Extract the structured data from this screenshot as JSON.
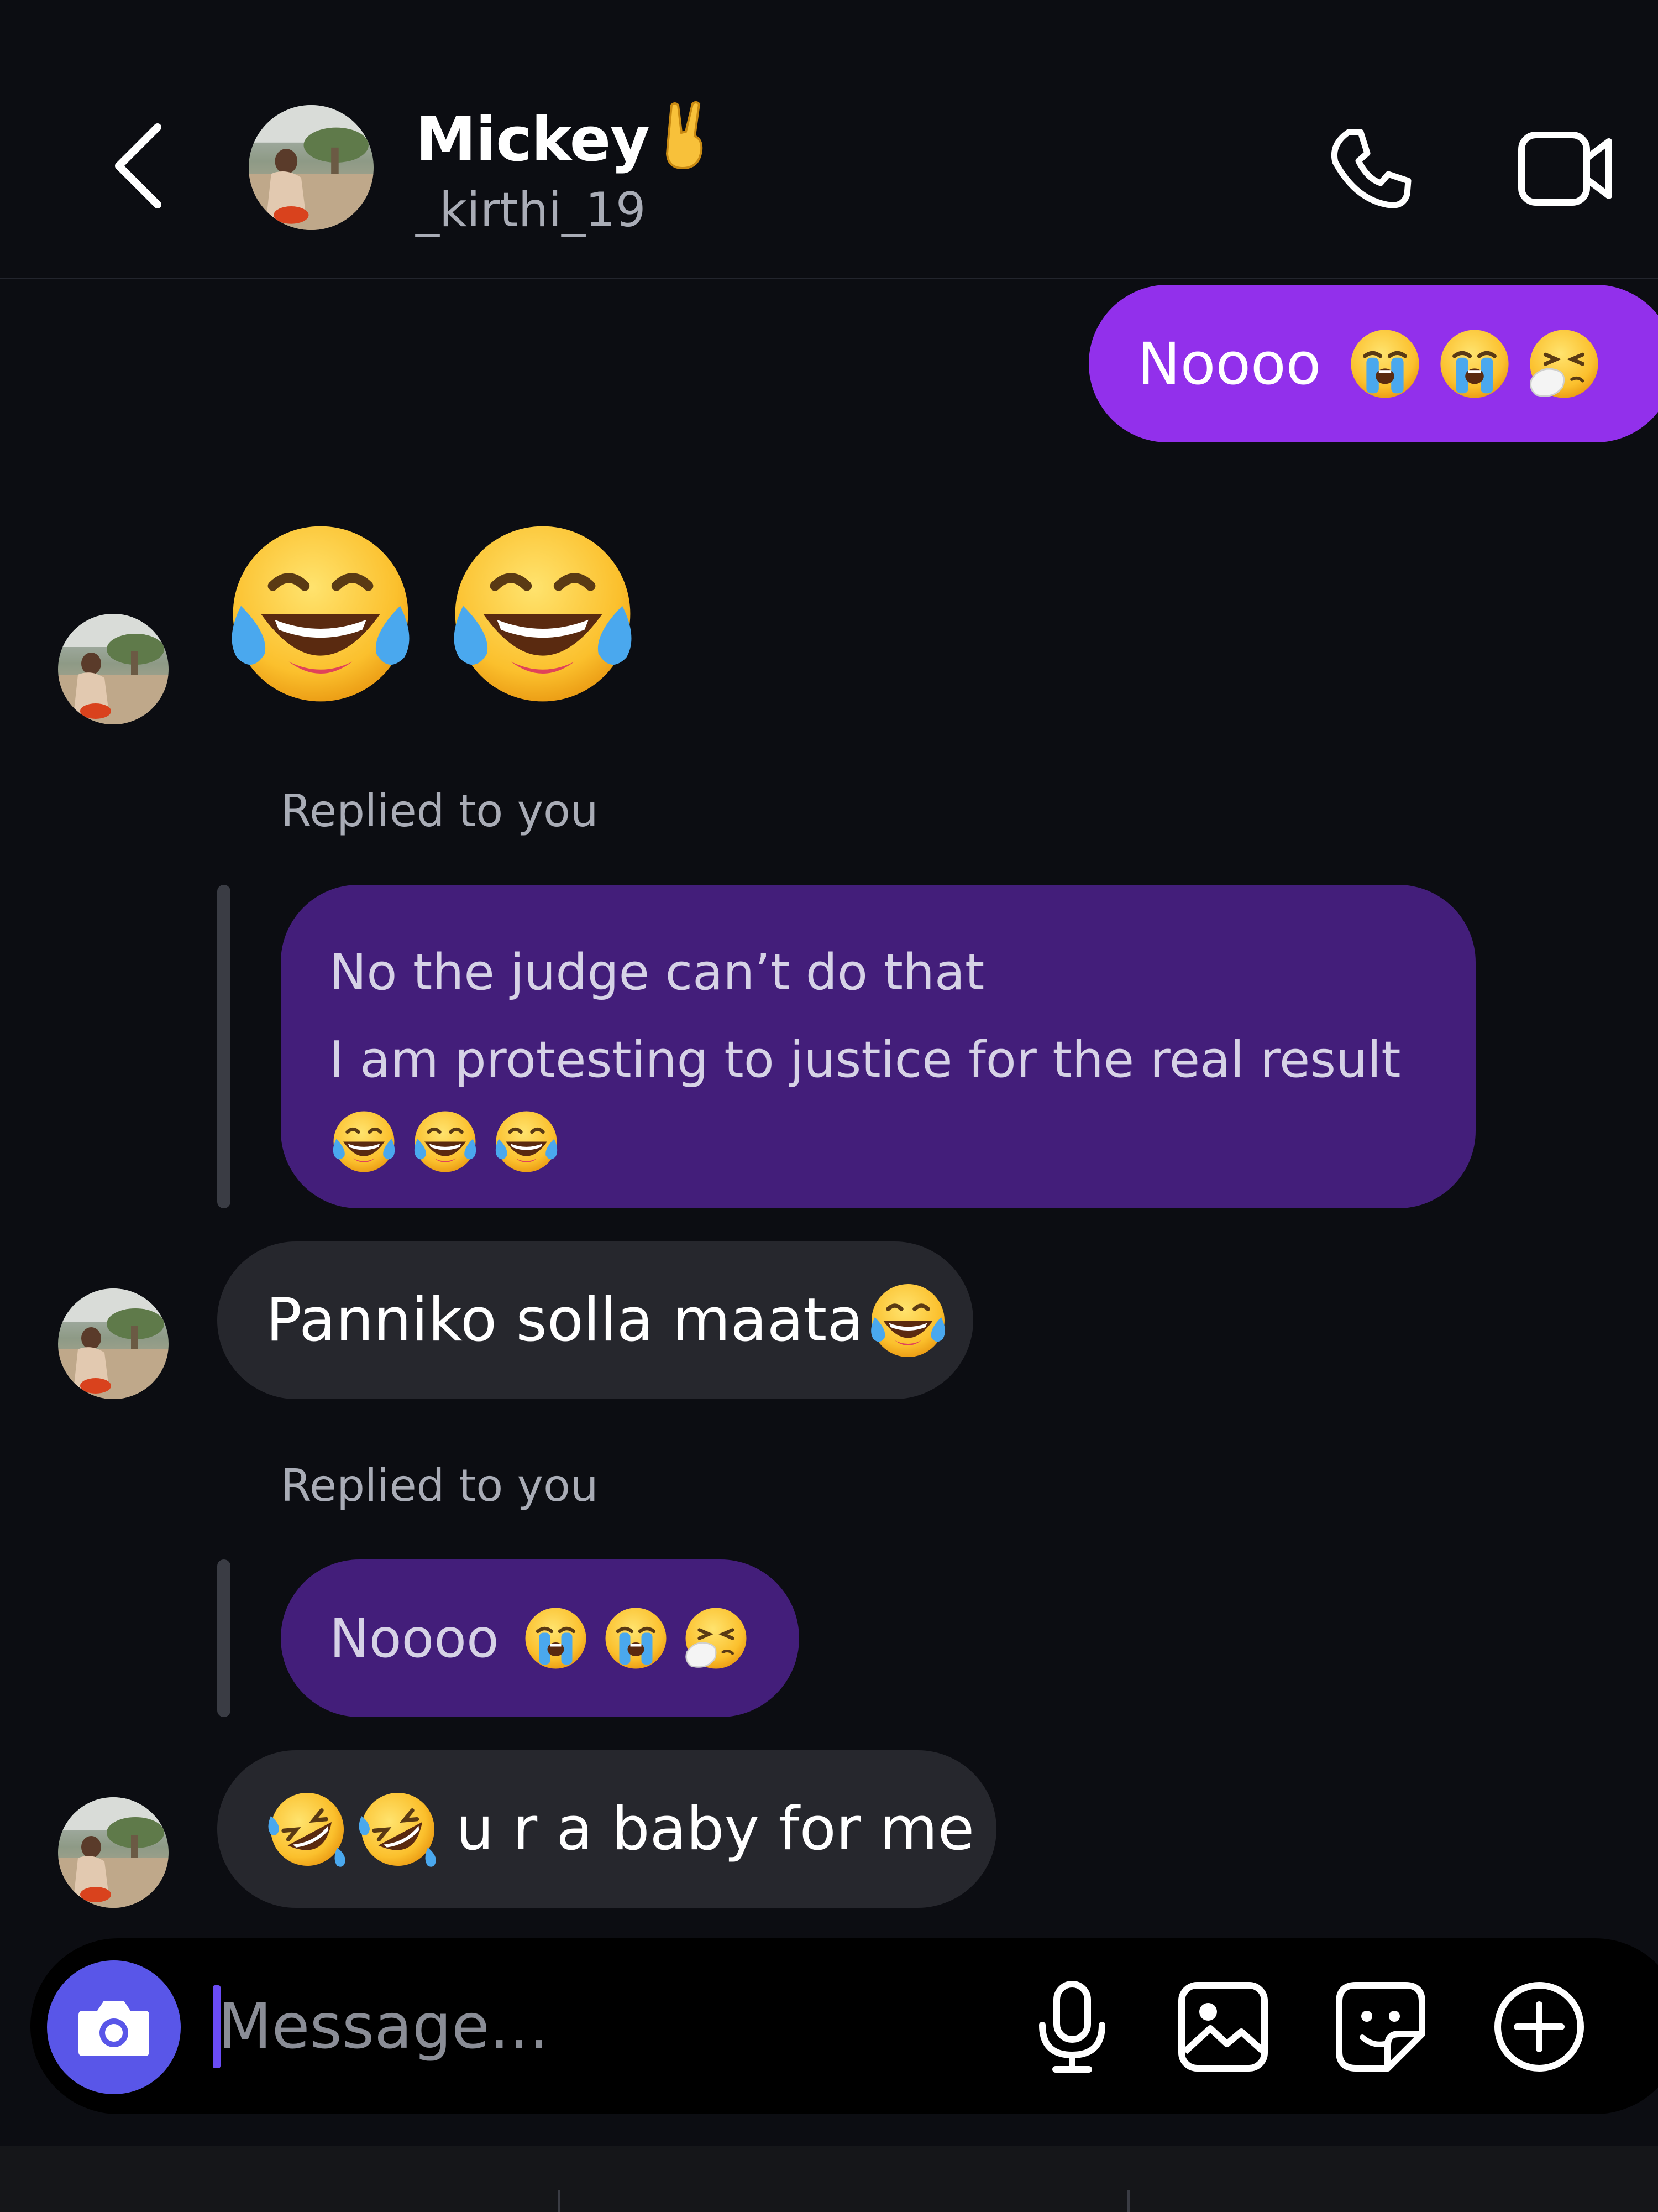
{
  "header": {
    "contact_name": "Mickey",
    "contact_username": "_kirthi_19"
  },
  "messages": [
    {
      "direction": "outgoing",
      "text": "Noooo",
      "emojis": [
        "loudly-crying-face",
        "loudly-crying-face",
        "sneezing-face"
      ]
    },
    {
      "direction": "incoming",
      "text": "",
      "emojis": [
        "tears-of-joy",
        "tears-of-joy"
      ]
    },
    {
      "direction": "incoming",
      "reply_label": "Replied to you",
      "quoted_lines": [
        "No the judge can’t do that",
        "I am protesting to justice for the real result"
      ],
      "quoted_emojis": [
        "tears-of-joy",
        "tears-of-joy",
        "tears-of-joy"
      ],
      "text": "Panniko solla maata",
      "emojis": [
        "tears-of-joy"
      ]
    },
    {
      "direction": "incoming",
      "reply_label": "Replied to you",
      "quoted_text": "Noooo",
      "quoted_emojis": [
        "loudly-crying-face",
        "loudly-crying-face",
        "sneezing-face"
      ],
      "text": "u r a baby for me",
      "emojis": [
        "rolling-on-floor-laughing",
        "rolling-on-floor-laughing"
      ]
    }
  ],
  "composer": {
    "placeholder": "Message...",
    "icons": [
      "camera-icon",
      "microphone-icon",
      "gallery-icon",
      "sticker-icon",
      "plus-circle-icon"
    ]
  },
  "colors": {
    "background": "#0c0d12",
    "outgoing_bubble": "#9230eb",
    "quoted_bubble": "#431e7a",
    "incoming_bubble": "#26272d",
    "camera_button": "#5956e8",
    "caret": "#6a4cf5"
  }
}
